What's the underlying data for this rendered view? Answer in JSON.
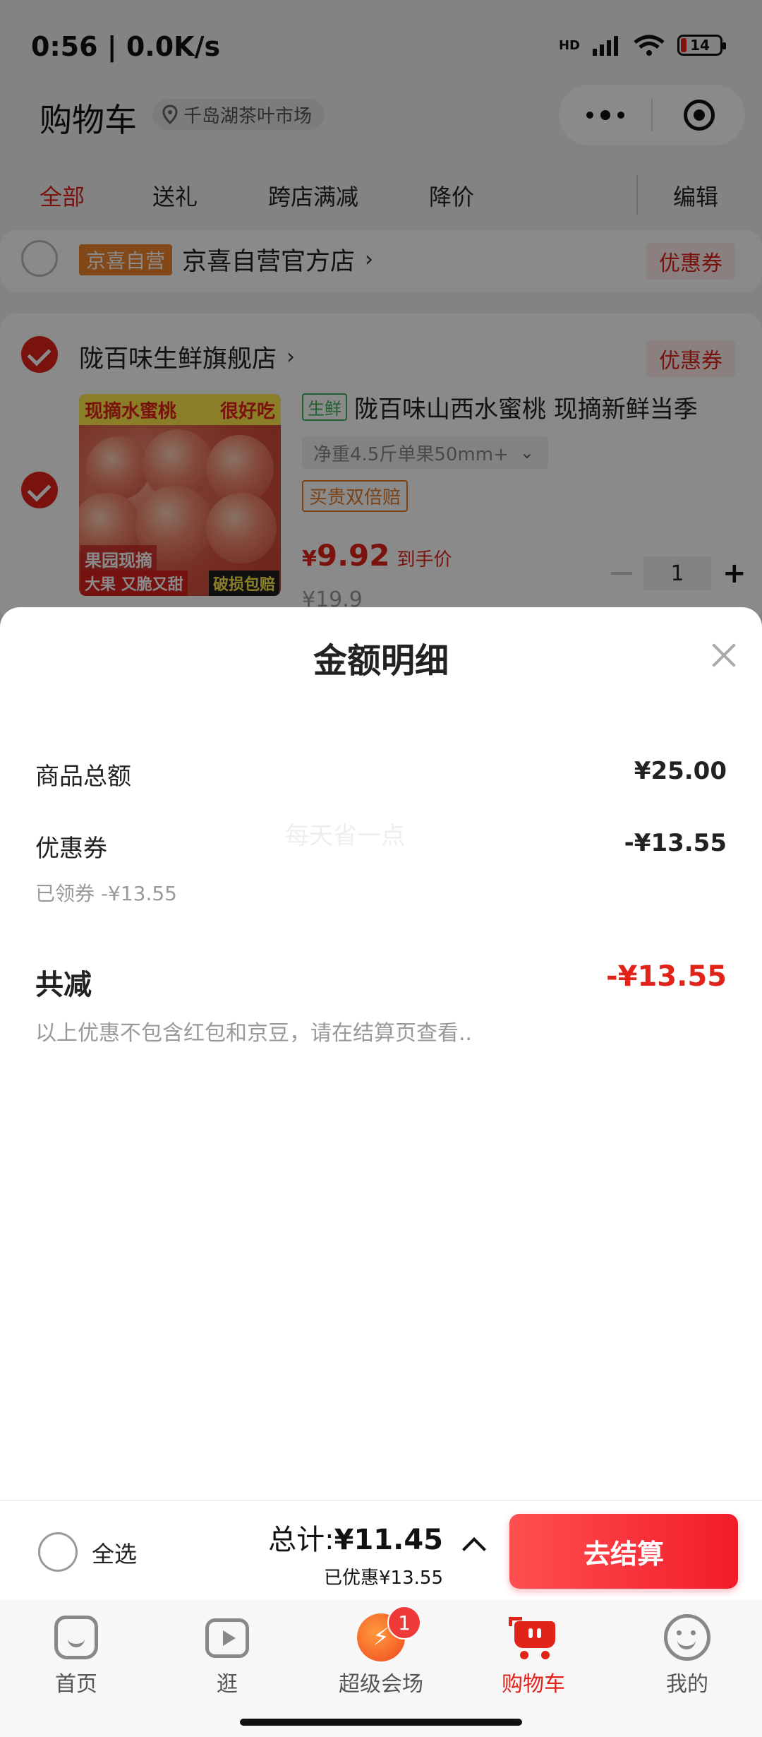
{
  "status_bar": {
    "time_speed": "0:56 | 0.0K/s",
    "network": "HD",
    "battery": "14"
  },
  "header": {
    "title": "购物车",
    "location": "千岛湖茶叶市场"
  },
  "tabs": [
    "全部",
    "送礼",
    "跨店满减",
    "降价"
  ],
  "edit_label": "编辑",
  "stores": [
    {
      "badge": "京喜自营",
      "name": "京喜自营官方店",
      "coupon": "优惠券",
      "checked": false
    },
    {
      "name": "陇百味生鲜旗舰店",
      "coupon": "优惠券",
      "checked": true
    }
  ],
  "product": {
    "fresh_tag": "生鲜",
    "title": "陇百味山西水蜜桃 现摘新鲜当季",
    "spec": "净重4.5斤单果50mm+",
    "guarantee": "买贵双倍赔",
    "price_symbol": "¥",
    "price": "9.92",
    "price_label": "到手价",
    "original_price": "¥19.9",
    "quantity": "1",
    "image_text": {
      "top_left": "现摘水蜜桃",
      "top_right": "很好吃",
      "bottom_left_1": "果园现摘",
      "bottom_left_2": "大果 又脆又甜",
      "bottom_right": "破损包赔"
    }
  },
  "sheet": {
    "title": "金额明细",
    "watermark": "每天省一点",
    "rows": [
      {
        "label": "商品总额",
        "value": "¥25.00"
      },
      {
        "label": "优惠券",
        "value": "-¥13.55",
        "note": "已领券 -¥13.55"
      }
    ],
    "total_label": "共减",
    "total_value": "-¥13.55",
    "disclaimer": "以上优惠不包含红包和京豆，请在结算页查看.."
  },
  "checkout": {
    "select_all": "全选",
    "total_prefix": "总计:",
    "total_amount": "¥11.45",
    "saved": "已优惠¥13.55",
    "button": "去结算"
  },
  "tabbar": [
    {
      "label": "首页",
      "icon": "home-icon"
    },
    {
      "label": "逛",
      "icon": "play-icon"
    },
    {
      "label": "超级会场",
      "icon": "super-venue-icon",
      "badge": "1"
    },
    {
      "label": "购物车",
      "icon": "cart-icon",
      "active": true
    },
    {
      "label": "我的",
      "icon": "profile-icon"
    }
  ],
  "colors": {
    "accent": "#e2231a",
    "orange": "#f0852d",
    "overlay": "rgba(0,0,0,0.46)"
  }
}
